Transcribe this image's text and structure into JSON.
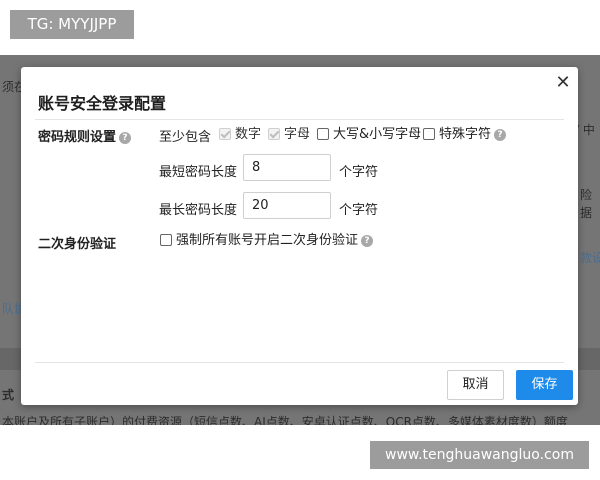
{
  "watermark_top": "TG: MYYJJPP",
  "watermark_bottom": "www.tenghuawangluo.com",
  "background": {
    "frag_left_top": "须在",
    "frag_right_top": "/ 中",
    "frag_right_mid1": "险",
    "frag_right_mid2": "据",
    "frag_right_link": "款设",
    "frag_left_mid": "队协",
    "frag_left_bottom": "式",
    "frag_bottom_line": "本账户及所有子账户）的付费资源（短信点数、AI点数、安卓认证点数、OCR点数、多媒体素材度数）额度"
  },
  "modal": {
    "title": "账号安全登录配置",
    "close_symbol": "✕",
    "password_rules": {
      "label": "密码规则设置",
      "at_least": "至少包含",
      "options": [
        {
          "label": "数字",
          "checked": true,
          "disabled": true
        },
        {
          "label": "字母",
          "checked": true,
          "disabled": true
        },
        {
          "label": "大写&小写字母",
          "checked": false,
          "disabled": false
        },
        {
          "label": "特殊字符",
          "checked": false,
          "disabled": false
        }
      ],
      "min_length_label": "最短密码长度",
      "min_length_value": "8",
      "max_length_label": "最长密码长度",
      "max_length_value": "20",
      "unit": "个字符"
    },
    "two_factor": {
      "label": "二次身份验证",
      "option_label": "强制所有账号开启二次身份验证",
      "checked": false
    },
    "footer": {
      "cancel_label": "取消",
      "save_label": "保存"
    }
  },
  "colors": {
    "primary": "#1e8bea",
    "overlay": "#757575"
  },
  "icons": {
    "help": "question-circle-icon",
    "close": "close-icon",
    "check": "check-icon"
  }
}
